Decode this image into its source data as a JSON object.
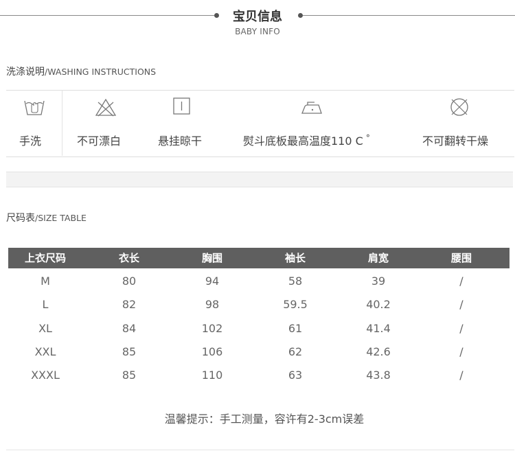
{
  "header": {
    "title": "宝贝信息",
    "subtitle": "BABY INFO"
  },
  "washing": {
    "title_cn": "洗涤说明",
    "title_en": "/WASHING INSTRUCTIONS",
    "items": [
      {
        "icon": "hand-wash-icon",
        "label": "手洗"
      },
      {
        "icon": "no-bleach-icon",
        "label": "不可漂白"
      },
      {
        "icon": "hang-dry-icon",
        "label": "悬挂晾干"
      },
      {
        "icon": "iron-icon",
        "label": "熨斗底板最高温度110 C",
        "sup": "°"
      },
      {
        "icon": "no-tumble-dry-icon",
        "label": "不可翻转干燥"
      }
    ]
  },
  "size_table": {
    "title_cn": "尺码表",
    "title_en": "/SIZE TABLE",
    "headers": [
      "上衣尺码",
      "衣长",
      "胸围",
      "袖长",
      "肩宽",
      "腰围"
    ],
    "rows": [
      [
        "M",
        "80",
        "94",
        "58",
        "39",
        "/"
      ],
      [
        "L",
        "82",
        "98",
        "59.5",
        "40.2",
        "/"
      ],
      [
        "XL",
        "84",
        "102",
        "61",
        "41.4",
        "/"
      ],
      [
        "XXL",
        "85",
        "106",
        "62",
        "42.6",
        "/"
      ],
      [
        "XXXL",
        "85",
        "110",
        "63",
        "43.8",
        "/"
      ]
    ]
  },
  "note": "温馨提示：手工测量，容许有2-3cm误差"
}
